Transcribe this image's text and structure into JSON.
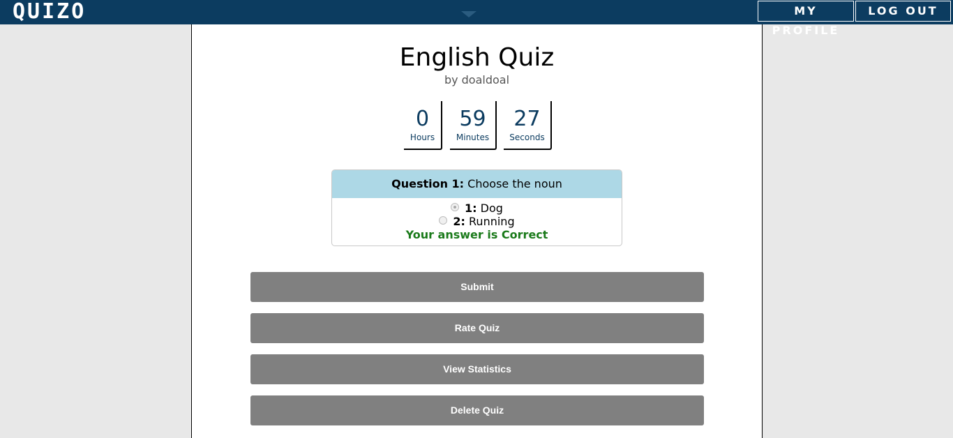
{
  "header": {
    "logo": "QUIZO",
    "my_profile": "MY PROFILE",
    "log_out": "LOG OUT"
  },
  "quiz": {
    "title": "English Quiz",
    "byline": "by doaldoal"
  },
  "timer": {
    "hours": "0",
    "hours_label": "Hours",
    "minutes": "59",
    "minutes_label": "Minutes",
    "seconds": "27",
    "seconds_label": "Seconds"
  },
  "question": {
    "label": "Question 1:",
    "text": "Choose the noun",
    "answers": [
      {
        "num": "1:",
        "text": "Dog",
        "selected": true
      },
      {
        "num": "2:",
        "text": "Running",
        "selected": false
      }
    ],
    "result": "Your answer is Correct"
  },
  "actions": {
    "submit": "Submit",
    "rate": "Rate Quiz",
    "stats": "View Statistics",
    "delete": "Delete Quiz"
  },
  "colors": {
    "header_bg": "#0c3c60",
    "question_header_bg": "#add8e6",
    "correct_text": "#1a7a1a",
    "button_bg": "#808080"
  }
}
